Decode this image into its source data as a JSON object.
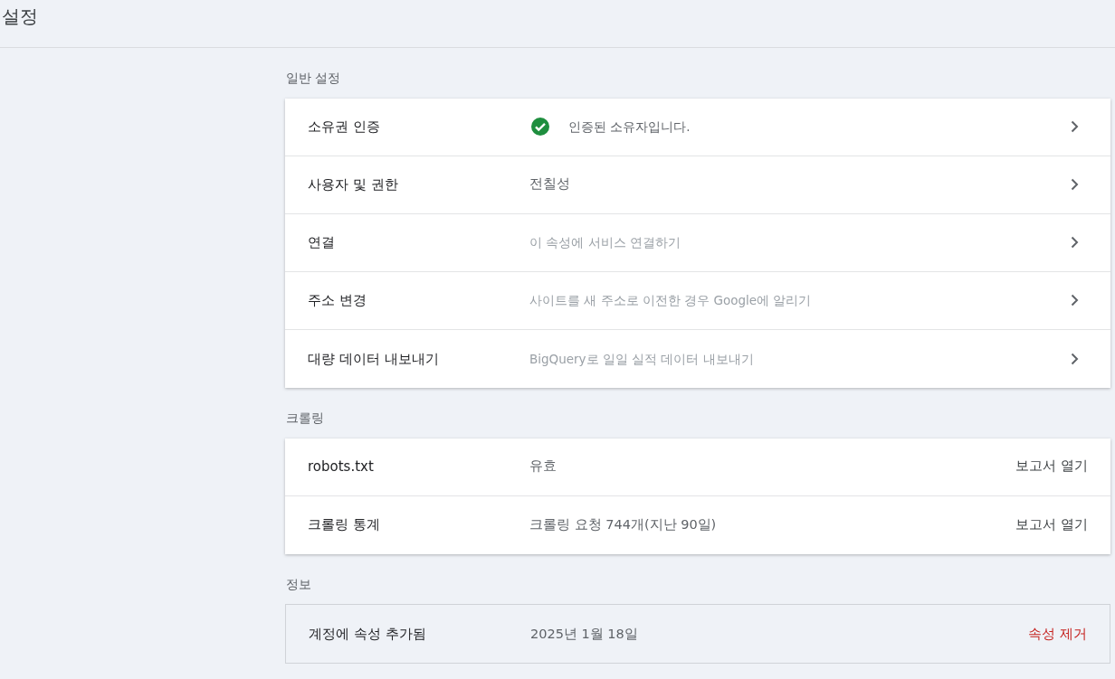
{
  "page_title": "설정",
  "sections": [
    {
      "title": "일반 설정",
      "kind": "raised",
      "rows": [
        {
          "label": "소유권 인증",
          "value": "인증된 소유자입니다.",
          "kind": "verified",
          "action": {
            "kind": "chevron"
          }
        },
        {
          "label": "사용자 및 권한",
          "value": "전칠성",
          "kind": "value",
          "action": {
            "kind": "chevron"
          }
        },
        {
          "label": "연결",
          "value": "이 속성에 서비스 연결하기",
          "kind": "hint",
          "action": {
            "kind": "chevron"
          }
        },
        {
          "label": "주소 변경",
          "value": "사이트를 새 주소로 이전한 경우 Google에 알리기",
          "kind": "hint",
          "action": {
            "kind": "chevron"
          }
        },
        {
          "label": "대량 데이터 내보내기",
          "value": "BigQuery로 일일 실적 데이터 내보내기",
          "kind": "hint",
          "action": {
            "kind": "chevron"
          }
        }
      ]
    },
    {
      "title": "크롤링",
      "kind": "raised",
      "rows": [
        {
          "label": "robots.txt",
          "value": "유효",
          "kind": "value",
          "action": {
            "kind": "link",
            "label": "보고서 열기"
          }
        },
        {
          "label": "크롤링 통계",
          "value": "크롤링 요청 744개(지난 90일)",
          "kind": "value",
          "action": {
            "kind": "link",
            "label": "보고서 열기"
          }
        }
      ]
    },
    {
      "title": "정보",
      "kind": "outlined",
      "rows": [
        {
          "label": "계정에 속성 추가됨",
          "value": "2025년 1월 18일",
          "kind": "value",
          "action": {
            "kind": "danger",
            "label": "속성 제거"
          }
        }
      ]
    }
  ]
}
